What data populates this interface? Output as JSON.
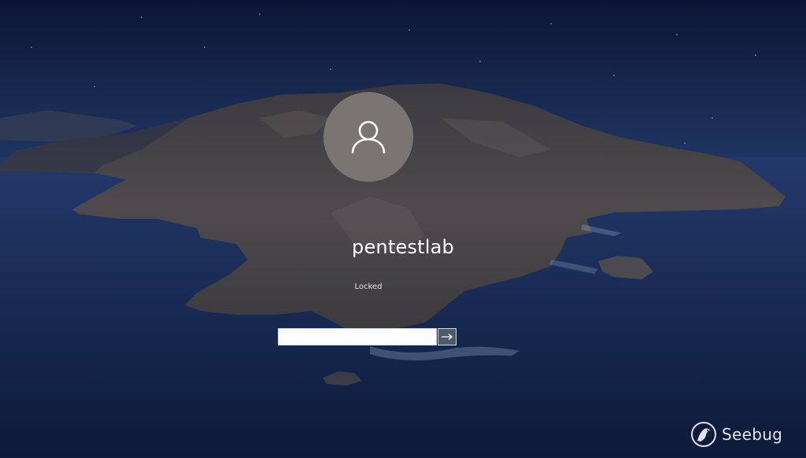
{
  "login": {
    "username": "pentestlab",
    "status": "Locked",
    "password_placeholder": "",
    "password_value": ""
  },
  "icons": {
    "avatar": "user-icon",
    "submit": "arrow-right-icon",
    "watermark": "seebug-logo"
  },
  "watermark": {
    "text": "Seebug"
  },
  "colors": {
    "sky": "#0f1d3e",
    "sea": "#1b2f58",
    "island": "#4e4a4c",
    "avatar_bg": "#7a7573",
    "submit_bg": "#4d5a6a"
  }
}
